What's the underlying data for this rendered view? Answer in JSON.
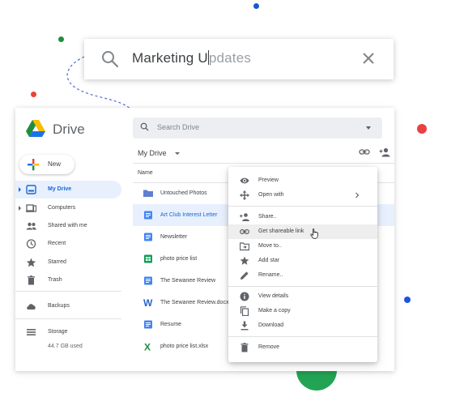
{
  "colors": {
    "accent_blue": "#1a73e8",
    "selected_bg": "#e8f0fe",
    "dot_blue": "#1a56db",
    "dot_green": "#1e8e3e",
    "dot_red": "#ea4335",
    "dot_bright_red": "#e94141",
    "half_circle_green": "#23a455"
  },
  "search_overlay": {
    "icon": "search-icon",
    "typed_text": "Marketing U",
    "suggestion_text": "pdates",
    "clear_icon": "close-icon"
  },
  "drive": {
    "app_title": "Drive",
    "search_placeholder": "Search Drive",
    "new_button_label": "New",
    "nav": [
      {
        "label": "My Drive",
        "icon": "my-drive-icon",
        "active": true
      },
      {
        "label": "Computers",
        "icon": "computers-icon"
      },
      {
        "label": "Shared with me",
        "icon": "people-icon"
      },
      {
        "label": "Recent",
        "icon": "clock-icon"
      },
      {
        "label": "Starred",
        "icon": "star-icon"
      },
      {
        "label": "Trash",
        "icon": "trash-icon"
      },
      {
        "label": "Backups",
        "icon": "cloud-icon"
      },
      {
        "label": "Storage",
        "icon": "storage-icon"
      }
    ],
    "storage_used": "44.7 GB used",
    "breadcrumb": "My Drive",
    "column_name": "Name",
    "files": [
      {
        "name": "Untouched Photos",
        "icon": "folder-icon"
      },
      {
        "name": "Art Club Interest Letter",
        "icon": "docs-icon",
        "selected": true
      },
      {
        "name": "Newsletter",
        "icon": "docs-icon"
      },
      {
        "name": "photo price list",
        "icon": "sheets-icon"
      },
      {
        "name": "The Sewanee Review",
        "icon": "docs-icon"
      },
      {
        "name": "The Sewanee Review.docx",
        "icon": "word-icon"
      },
      {
        "name": "Resume",
        "icon": "docs-icon"
      },
      {
        "name": "photo price list.xlsx",
        "icon": "excel-icon"
      }
    ]
  },
  "context_menu": {
    "items": [
      {
        "label": "Preview",
        "icon": "eye-icon"
      },
      {
        "label": "Open with",
        "icon": "open-with-icon",
        "submenu": true
      },
      {
        "label": "Share..",
        "icon": "person-add-icon"
      },
      {
        "label": "Get shareable link",
        "icon": "link-icon",
        "hover": true
      },
      {
        "label": "Move to..",
        "icon": "move-folder-icon"
      },
      {
        "label": "Add star",
        "icon": "star-icon"
      },
      {
        "label": "Rename..",
        "icon": "pencil-icon"
      },
      {
        "label": "View details",
        "icon": "info-icon"
      },
      {
        "label": "Make a copy",
        "icon": "copy-icon"
      },
      {
        "label": "Download",
        "icon": "download-icon"
      },
      {
        "label": "Remove",
        "icon": "trash-icon"
      }
    ]
  }
}
